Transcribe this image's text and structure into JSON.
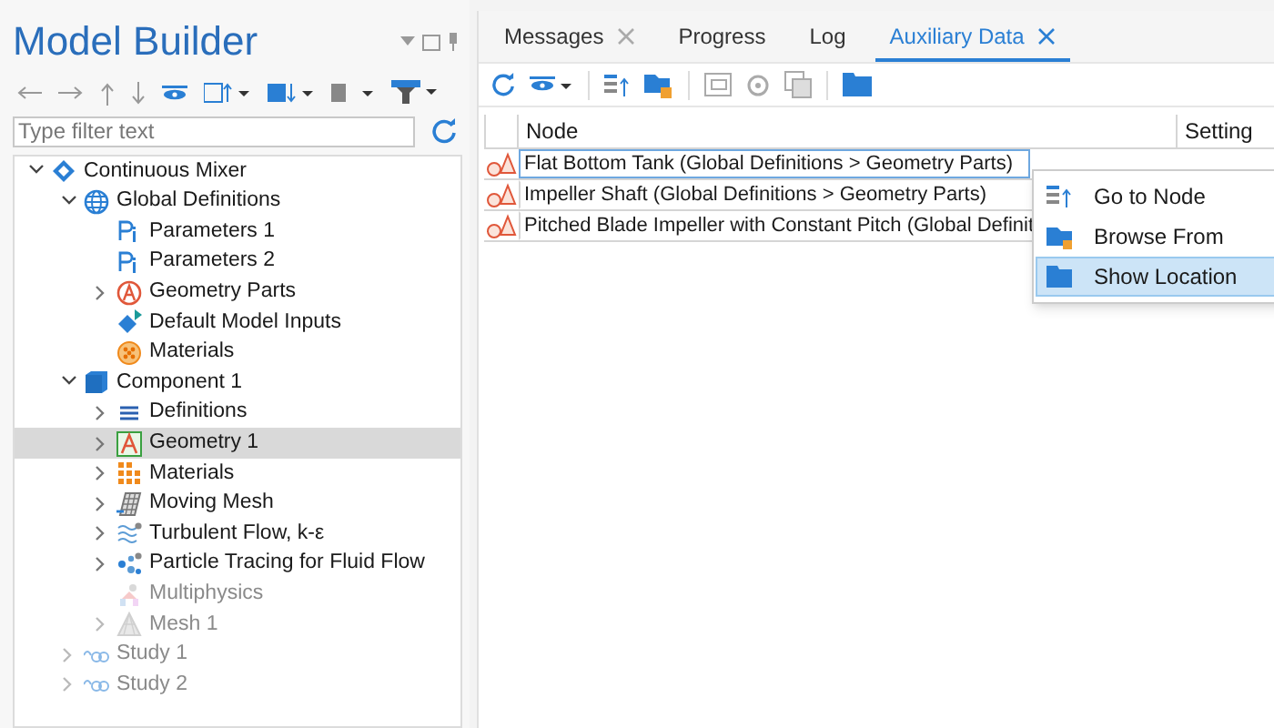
{
  "model_builder": {
    "title": "Model Builder",
    "filter": {
      "placeholder": "Type filter text"
    },
    "tree": [
      {
        "label": "Continuous Mixer",
        "kind": "model",
        "expanded": true,
        "selected": false,
        "disabled": false,
        "children": [
          {
            "label": "Global Definitions",
            "kind": "globe",
            "expanded": true,
            "selected": false,
            "disabled": false,
            "children": [
              {
                "label": "Parameters 1",
                "kind": "param",
                "selected": false,
                "disabled": false
              },
              {
                "label": "Parameters 2",
                "kind": "param",
                "selected": false,
                "disabled": false
              },
              {
                "label": "Geometry Parts",
                "kind": "parts",
                "expanded": false,
                "selected": false,
                "disabled": false
              },
              {
                "label": "Default Model Inputs",
                "kind": "inputs",
                "selected": false,
                "disabled": false
              },
              {
                "label": "Materials",
                "kind": "materials-global",
                "selected": false,
                "disabled": false
              }
            ]
          },
          {
            "label": "Component 1",
            "kind": "component",
            "expanded": true,
            "selected": false,
            "disabled": false,
            "children": [
              {
                "label": "Definitions",
                "kind": "definitions",
                "expanded": false,
                "selected": false,
                "disabled": false
              },
              {
                "label": "Geometry 1",
                "kind": "geometry",
                "expanded": false,
                "selected": true,
                "disabled": false
              },
              {
                "label": "Materials",
                "kind": "materials",
                "expanded": false,
                "selected": false,
                "disabled": false
              },
              {
                "label": "Moving Mesh",
                "kind": "moving-mesh",
                "expanded": false,
                "selected": false,
                "disabled": false
              },
              {
                "label": "Turbulent Flow, k-ε",
                "kind": "flow",
                "expanded": false,
                "selected": false,
                "disabled": false
              },
              {
                "label": "Particle Tracing for Fluid Flow",
                "kind": "particles",
                "expanded": false,
                "selected": false,
                "disabled": false
              },
              {
                "label": "Multiphysics",
                "kind": "multiphysics",
                "selected": false,
                "disabled": true
              },
              {
                "label": "Mesh 1",
                "kind": "mesh",
                "expanded": false,
                "selected": false,
                "disabled": true
              }
            ]
          },
          {
            "label": "Study 1",
            "kind": "study",
            "expanded": false,
            "selected": false,
            "disabled": true
          },
          {
            "label": "Study 2",
            "kind": "study",
            "expanded": false,
            "selected": false,
            "disabled": true
          }
        ]
      }
    ]
  },
  "tabs": [
    {
      "label": "Messages",
      "selected": false,
      "closable": true
    },
    {
      "label": "Progress",
      "selected": false,
      "closable": false
    },
    {
      "label": "Log",
      "selected": false,
      "closable": false
    },
    {
      "label": "Auxiliary Data",
      "selected": true,
      "closable": true
    }
  ],
  "table": {
    "columns": [
      "Node",
      "Setting"
    ],
    "rows": [
      {
        "node": "Flat Bottom Tank (Global Definitions > Geometry Parts)",
        "selected": true
      },
      {
        "node": "Impeller Shaft (Global Definitions > Geometry Parts)",
        "selected": false
      },
      {
        "node": "Pitched Blade Impeller with Constant Pitch (Global Definit",
        "selected": false
      }
    ]
  },
  "context_menu": [
    {
      "label": "Go to Node",
      "kind": "goto",
      "selected": false
    },
    {
      "label": "Browse From",
      "kind": "browse",
      "selected": false
    },
    {
      "label": "Show Location",
      "kind": "folder",
      "selected": true
    }
  ]
}
